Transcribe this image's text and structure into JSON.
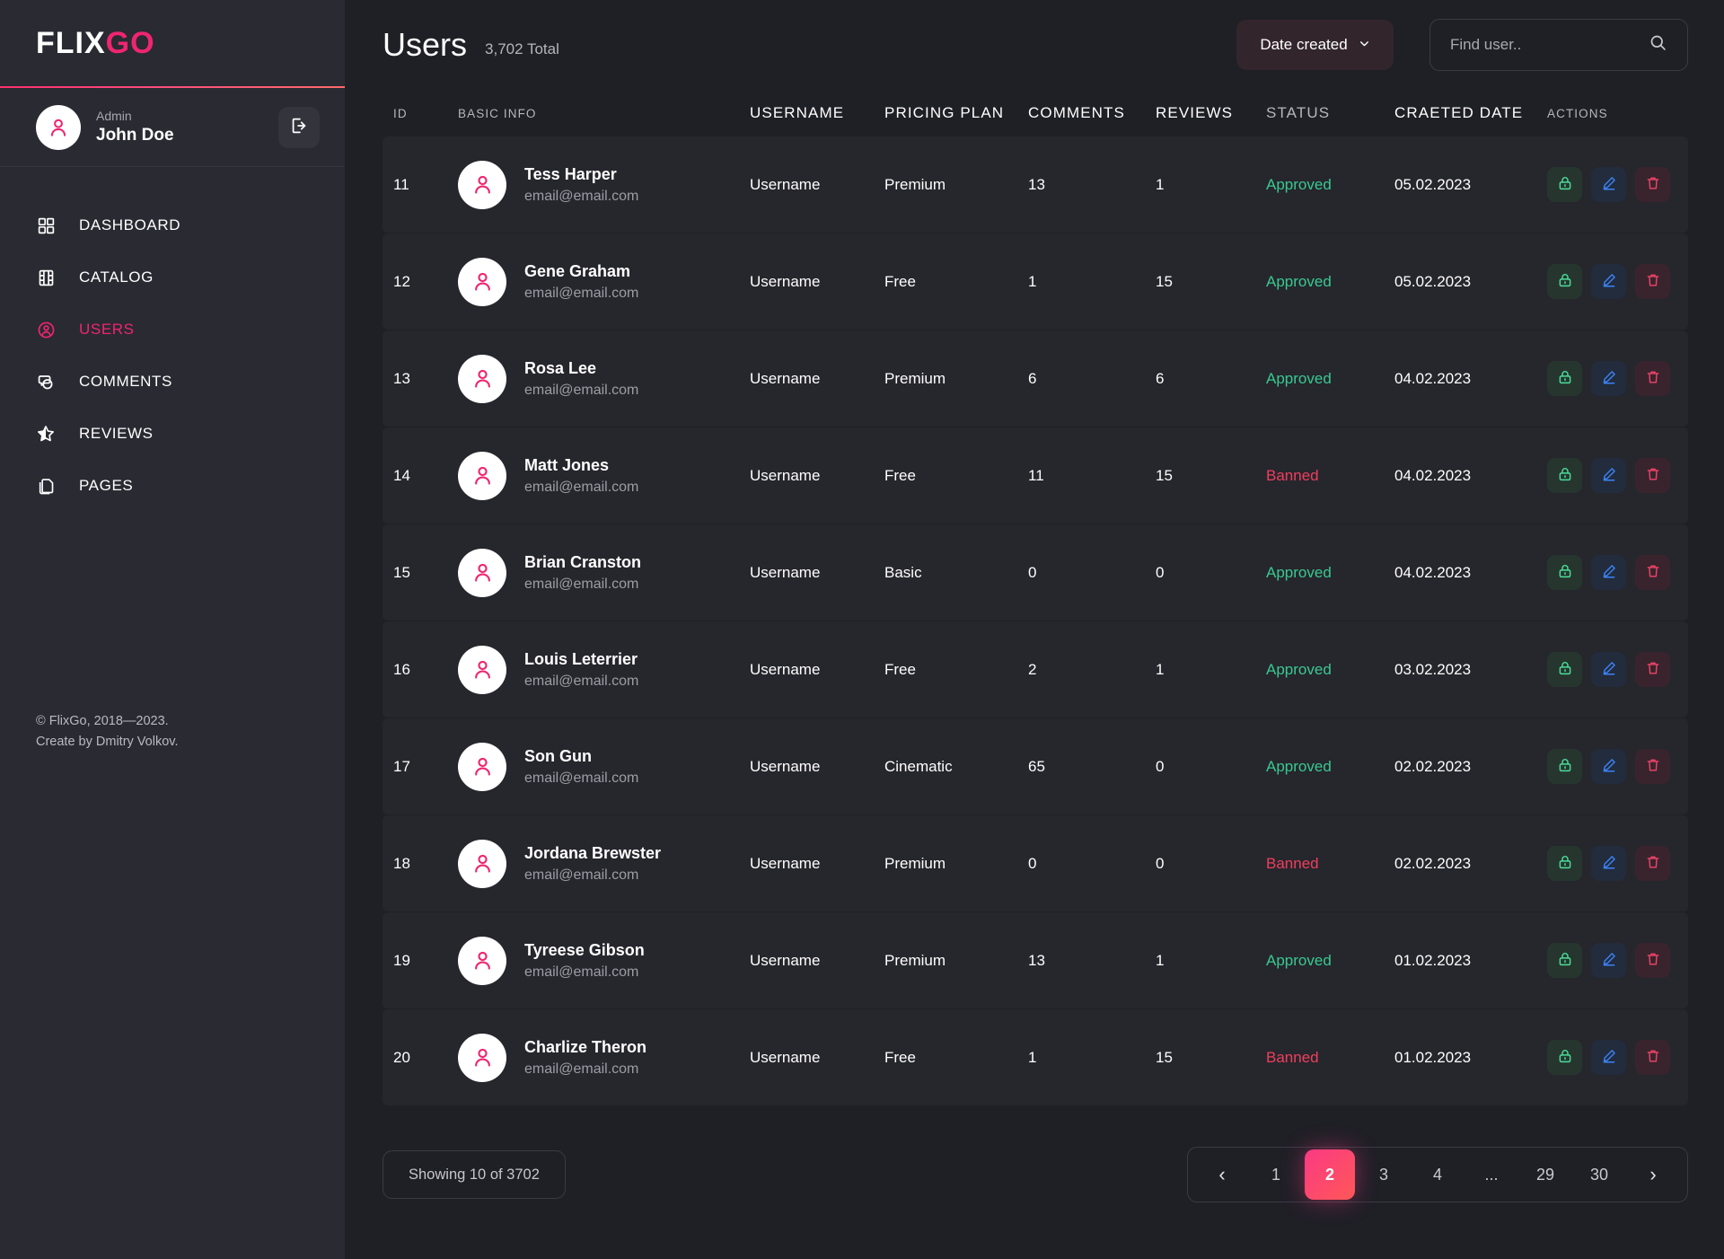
{
  "brand": {
    "part1": "FLIX",
    "part2": "GO"
  },
  "user": {
    "role": "Admin",
    "name": "John Doe",
    "logout_icon": "logout-icon"
  },
  "sidebar": {
    "items": [
      {
        "label": "DASHBOARD",
        "icon": "grid-icon",
        "active": false
      },
      {
        "label": "CATALOG",
        "icon": "film-icon",
        "active": false
      },
      {
        "label": "USERS",
        "icon": "user-circle-icon",
        "active": true
      },
      {
        "label": "COMMENTS",
        "icon": "chat-icon",
        "active": false
      },
      {
        "label": "REVIEWS",
        "icon": "star-icon",
        "active": false
      },
      {
        "label": "PAGES",
        "icon": "copy-icon",
        "active": false
      }
    ],
    "footer_line1": "© FlixGo, 2018—2023.",
    "footer_line2": "Create by Dmitry Volkov."
  },
  "header": {
    "title": "Users",
    "total": "3,702 Total",
    "sort_label": "Date created",
    "sort_icon": "chevron-down-icon",
    "search_placeholder": "Find user..",
    "search_value": "",
    "search_icon": "search-icon"
  },
  "table": {
    "columns": [
      "ID",
      "BASIC INFO",
      "USERNAME",
      "PRICING PLAN",
      "COMMENTS",
      "REVIEWS",
      "STATUS",
      "CRAETED DATE",
      "ACTIONS"
    ],
    "actions": [
      {
        "name": "ban-button",
        "icon": "lock-icon",
        "color": "#4ade9a"
      },
      {
        "name": "edit-button",
        "icon": "pencil-icon",
        "color": "#3b82f6"
      },
      {
        "name": "delete-button",
        "icon": "trash-icon",
        "color": "#f0436a"
      }
    ],
    "rows": [
      {
        "id": "11",
        "name": "Tess Harper",
        "email": "email@email.com",
        "username": "Username",
        "plan": "Premium",
        "comments": "13",
        "reviews": "1",
        "status": "Approved",
        "date": "05.02.2023"
      },
      {
        "id": "12",
        "name": "Gene Graham",
        "email": "email@email.com",
        "username": "Username",
        "plan": "Free",
        "comments": "1",
        "reviews": "15",
        "status": "Approved",
        "date": "05.02.2023"
      },
      {
        "id": "13",
        "name": "Rosa Lee",
        "email": "email@email.com",
        "username": "Username",
        "plan": "Premium",
        "comments": "6",
        "reviews": "6",
        "status": "Approved",
        "date": "04.02.2023"
      },
      {
        "id": "14",
        "name": "Matt Jones",
        "email": "email@email.com",
        "username": "Username",
        "plan": "Free",
        "comments": "11",
        "reviews": "15",
        "status": "Banned",
        "date": "04.02.2023"
      },
      {
        "id": "15",
        "name": "Brian Cranston",
        "email": "email@email.com",
        "username": "Username",
        "plan": "Basic",
        "comments": "0",
        "reviews": "0",
        "status": "Approved",
        "date": "04.02.2023"
      },
      {
        "id": "16",
        "name": "Louis Leterrier",
        "email": "email@email.com",
        "username": "Username",
        "plan": "Free",
        "comments": "2",
        "reviews": "1",
        "status": "Approved",
        "date": "03.02.2023"
      },
      {
        "id": "17",
        "name": "Son Gun",
        "email": "email@email.com",
        "username": "Username",
        "plan": "Cinematic",
        "comments": "65",
        "reviews": "0",
        "status": "Approved",
        "date": "02.02.2023"
      },
      {
        "id": "18",
        "name": "Jordana Brewster",
        "email": "email@email.com",
        "username": "Username",
        "plan": "Premium",
        "comments": "0",
        "reviews": "0",
        "status": "Banned",
        "date": "02.02.2023"
      },
      {
        "id": "19",
        "name": "Tyreese Gibson",
        "email": "email@email.com",
        "username": "Username",
        "plan": "Premium",
        "comments": "13",
        "reviews": "1",
        "status": "Approved",
        "date": "01.02.2023"
      },
      {
        "id": "20",
        "name": "Charlize Theron",
        "email": "email@email.com",
        "username": "Username",
        "plan": "Free",
        "comments": "1",
        "reviews": "15",
        "status": "Banned",
        "date": "01.02.2023"
      }
    ]
  },
  "footer": {
    "showing": "Showing 10 of 3702",
    "pagination": {
      "prev_icon": "chevron-left-icon",
      "next_icon": "chevron-right-icon",
      "pages": [
        "1",
        "2",
        "3",
        "4",
        "...",
        "29",
        "30"
      ],
      "active": "2"
    }
  },
  "colors": {
    "accent": "#f0256f",
    "approved": "#39c98f",
    "banned": "#ef3f5c",
    "sidebar_bg": "#2a2a32",
    "page_bg": "#1f1f26",
    "row_bg": "#26262d"
  }
}
